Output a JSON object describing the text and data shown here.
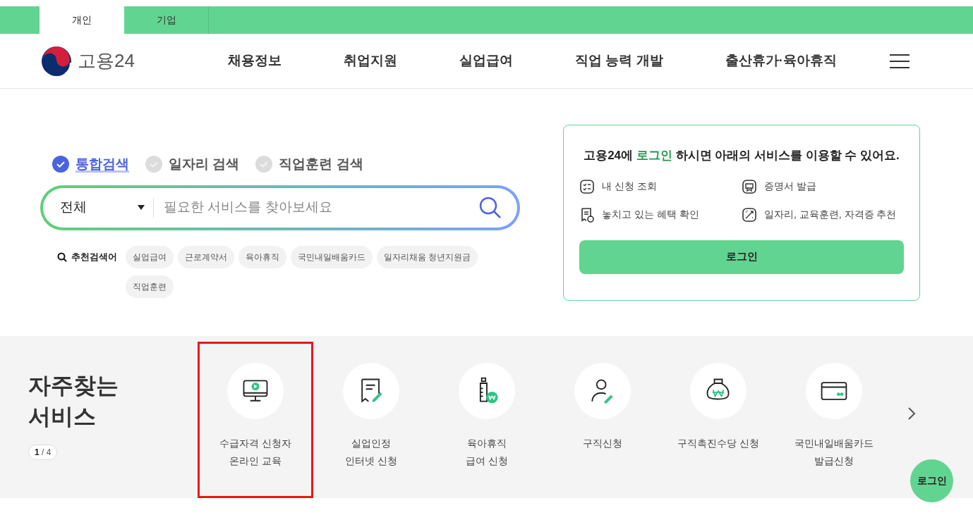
{
  "audience_tabs": [
    {
      "label": "개인",
      "selected": true
    },
    {
      "label": "기업",
      "selected": false
    }
  ],
  "header": {
    "logo_text": "고용24",
    "nav": [
      "채용정보",
      "취업지원",
      "실업급여",
      "직업 능력 개발",
      "출산휴가·육아휴직"
    ]
  },
  "search": {
    "modes": [
      {
        "label": "통합검색",
        "selected": true
      },
      {
        "label": "일자리 검색",
        "selected": false
      },
      {
        "label": "직업훈련 검색",
        "selected": false
      }
    ],
    "category": "전체",
    "placeholder": "필요한 서비스를 찾아보세요",
    "recommended_label": "추천검색어",
    "keywords": [
      "실업급여",
      "근로계약서",
      "육아휴직",
      "국민내일배움카드",
      "일자리채움 청년지원금",
      "직업훈련"
    ]
  },
  "login_card": {
    "message_before": "고용24에",
    "message_link": "로그인",
    "message_after": "하시면 아래의 서비스를 이용할 수 있어요.",
    "features": [
      {
        "kind": "checklist",
        "label": "내 신청 조회"
      },
      {
        "kind": "certificate",
        "label": "증명서 발급"
      },
      {
        "kind": "receipt",
        "label": "놓치고 있는 혜택 확인"
      },
      {
        "kind": "wand",
        "label": "일자리, 교육훈련, 자격증 추천"
      }
    ],
    "button": "로그인"
  },
  "frequent_services": {
    "title": "자주찾는 서비스",
    "page": "1",
    "page_separator": "/",
    "page_total": "4",
    "items": [
      {
        "kind": "monitor",
        "label": "수급자격 신청자\n온라인 교육",
        "highlighted": true
      },
      {
        "kind": "document",
        "label": "실업인정\n인터넷 신청",
        "highlighted": false
      },
      {
        "kind": "bottle",
        "label": "육아휴직\n급여 신청",
        "highlighted": false
      },
      {
        "kind": "person",
        "label": "구직신청",
        "highlighted": false
      },
      {
        "kind": "moneybag",
        "label": "구직촉진수당 신청",
        "highlighted": false
      },
      {
        "kind": "card",
        "label": "국민내일배움카드\n발급신청",
        "highlighted": false
      }
    ]
  },
  "floating_button": "로그인"
}
